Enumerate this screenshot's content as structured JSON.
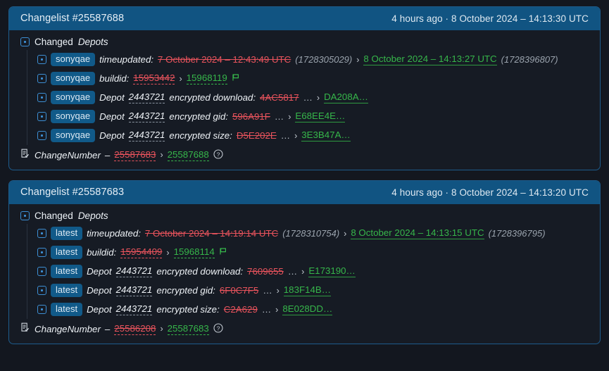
{
  "page": {
    "background": "#13171f",
    "accent": "#115482",
    "old_color": "#e8535c",
    "new_color": "#36b64a"
  },
  "cards": [
    {
      "header": {
        "title": "Changelist #25587688",
        "meta": "4 hours ago · 8 October 2024 – 14:13:30 UTC"
      },
      "group": {
        "label": "Changed",
        "kind": "Depots"
      },
      "rows": [
        {
          "badge": "sonyqae",
          "field": "timeupdated:",
          "old": "7 October 2024 – 12:43:49 UTC",
          "old_epoch": "(1728305029)",
          "arrow": "›",
          "new": "8 October 2024 – 14:13:27 UTC",
          "new_epoch": "(1728396807)",
          "flag": false
        },
        {
          "badge": "sonyqae",
          "field": "buildid:",
          "old": "15953442",
          "old_epoch": "",
          "arrow": "›",
          "new": "15968119",
          "new_epoch": "",
          "flag": true
        },
        {
          "badge": "sonyqae",
          "prefix": "Depot",
          "depot": "2443721",
          "field": "encrypted download:",
          "old": "4AC5817",
          "old_ellipsis": "…",
          "arrow": "›",
          "new": "DA208A…",
          "flag": false
        },
        {
          "badge": "sonyqae",
          "prefix": "Depot",
          "depot": "2443721",
          "field": "encrypted gid:",
          "old": "596A91F",
          "old_ellipsis": "…",
          "arrow": "›",
          "new": "E68EE4E…",
          "flag": false
        },
        {
          "badge": "sonyqae",
          "prefix": "Depot",
          "depot": "2443721",
          "field": "encrypted size:",
          "old": "D5E202E",
          "old_ellipsis": "…",
          "arrow": "›",
          "new": "3E3B47A…",
          "flag": false
        }
      ],
      "footer": {
        "label": "ChangeNumber",
        "dash": "–",
        "old": "25587683",
        "arrow": "›",
        "new": "25587688",
        "help": "?"
      }
    },
    {
      "header": {
        "title": "Changelist #25587683",
        "meta": "4 hours ago · 8 October 2024 – 14:13:20 UTC"
      },
      "group": {
        "label": "Changed",
        "kind": "Depots"
      },
      "rows": [
        {
          "badge": "latest",
          "field": "timeupdated:",
          "old": "7 October 2024 – 14:19:14 UTC",
          "old_epoch": "(1728310754)",
          "arrow": "›",
          "new": "8 October 2024 – 14:13:15 UTC",
          "new_epoch": "(1728396795)",
          "flag": false
        },
        {
          "badge": "latest",
          "field": "buildid:",
          "old": "15954409",
          "old_epoch": "",
          "arrow": "›",
          "new": "15968114",
          "new_epoch": "",
          "flag": true
        },
        {
          "badge": "latest",
          "prefix": "Depot",
          "depot": "2443721",
          "field": "encrypted download:",
          "old": "7609655",
          "old_ellipsis": "…",
          "arrow": "›",
          "new": "E173190…",
          "flag": false
        },
        {
          "badge": "latest",
          "prefix": "Depot",
          "depot": "2443721",
          "field": "encrypted gid:",
          "old": "6F0C7F5",
          "old_ellipsis": "…",
          "arrow": "›",
          "new": "183F14B…",
          "flag": false
        },
        {
          "badge": "latest",
          "prefix": "Depot",
          "depot": "2443721",
          "field": "encrypted size:",
          "old": "C2A629",
          "old_ellipsis": "…",
          "arrow": "›",
          "new": "8E028DD…",
          "flag": false
        }
      ],
      "footer": {
        "label": "ChangeNumber",
        "dash": "–",
        "old": "25586208",
        "arrow": "›",
        "new": "25587683",
        "help": "?"
      }
    }
  ]
}
